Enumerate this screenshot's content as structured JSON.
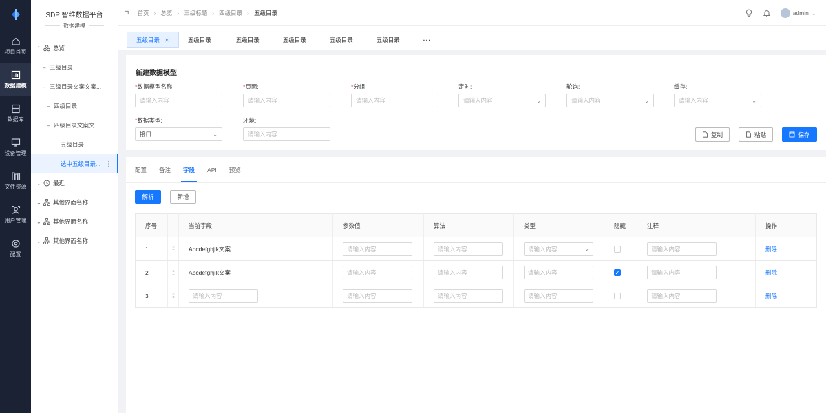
{
  "rail": [
    {
      "icon": "home-icon",
      "label": "项目首页"
    },
    {
      "icon": "chart-icon",
      "label": "数据建模"
    },
    {
      "icon": "database-icon",
      "label": "数据库"
    },
    {
      "icon": "monitor-icon",
      "label": "设备管理"
    },
    {
      "icon": "files-icon",
      "label": "文件资源"
    },
    {
      "icon": "user-manage-icon",
      "label": "用户管理"
    },
    {
      "icon": "settings-icon",
      "label": "配置"
    }
  ],
  "sidebar": {
    "title": "SDP 智维数据平台",
    "subtitle": "数据建模",
    "nodes": [
      {
        "label": "总览"
      },
      {
        "label": "三级目录"
      },
      {
        "label": "三级目录文案文案..."
      },
      {
        "label": "四级目录"
      },
      {
        "label": "四级目录文案文..."
      },
      {
        "label": "五级目录"
      },
      {
        "label": "选中五级目录..."
      },
      {
        "label": "最近"
      },
      {
        "label": "其他界面名称"
      },
      {
        "label": "其他界面名称"
      },
      {
        "label": "其他界面名称"
      }
    ]
  },
  "breadcrumb": [
    "首页",
    "总览",
    "三级标题",
    "四级目录",
    "五级目录"
  ],
  "user": {
    "name": "admin"
  },
  "tabs": [
    "五级目录",
    "五级目录",
    "五级目录",
    "五级目录",
    "五级目录",
    "五级目录"
  ],
  "tabs_more": "···",
  "form": {
    "title": "新建数据模型",
    "fields": [
      {
        "label": "数据模型名称:",
        "placeholder": "请输入内容"
      },
      {
        "label": "页面:",
        "placeholder": "请输入内容"
      },
      {
        "label": "分组:",
        "placeholder": "请输入内容"
      },
      {
        "label": "定时:",
        "placeholder": "请输入内容"
      },
      {
        "label": "轮询:",
        "placeholder": "请输入内容"
      },
      {
        "label": "缓存:",
        "placeholder": "请输入内容"
      },
      {
        "label": "数据类型:",
        "value": "接口"
      },
      {
        "label": "环境:",
        "placeholder": "请输入内容"
      }
    ],
    "copy_label": "复制",
    "paste_label": "粘贴",
    "save_label": "保存"
  },
  "subtabs": [
    "配置",
    "备注",
    "字段",
    "API",
    "预览"
  ],
  "actions": {
    "parse_label": "解析",
    "add_label": "新增"
  },
  "table": {
    "headers": [
      "序号",
      "当前字段",
      "参数值",
      "算法",
      "类型",
      "隐藏",
      "注释",
      "操作"
    ],
    "placeholder": "请输入内容",
    "rows": [
      {
        "index": "1",
        "field": "Abcdefghjik文案",
        "hidden": false,
        "action": "删除"
      },
      {
        "index": "2",
        "field": "Abcdefghjik文案",
        "hidden": true,
        "action": "删除"
      },
      {
        "index": "3",
        "field": "",
        "hidden": false,
        "action": "删除"
      }
    ]
  },
  "colors": {
    "primary": "#1677ff",
    "rail_bg": "#1b2233",
    "required": "#e54848"
  }
}
